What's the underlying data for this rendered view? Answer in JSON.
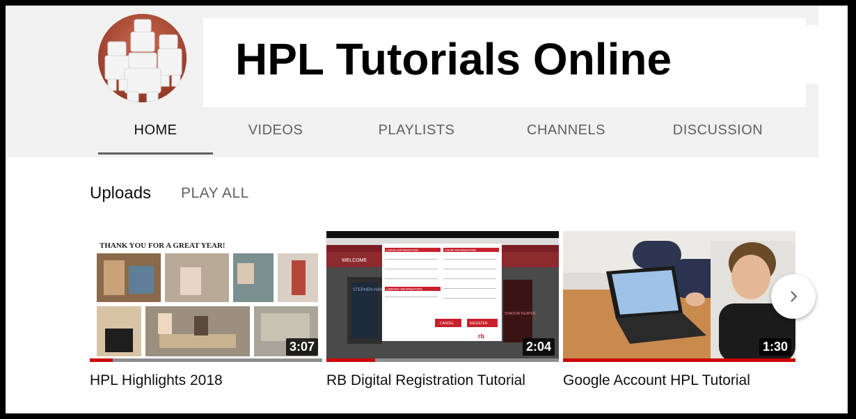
{
  "channel": {
    "title": "HPL Tutorials Online"
  },
  "tabs": [
    {
      "label": "HOME",
      "active": true
    },
    {
      "label": "VIDEOS"
    },
    {
      "label": "PLAYLISTS"
    },
    {
      "label": "CHANNELS"
    },
    {
      "label": "DISCUSSION"
    }
  ],
  "section": {
    "title": "Uploads",
    "play_all": "PLAY ALL"
  },
  "videos": [
    {
      "title": "HPL Highlights 2018",
      "duration": "3:07",
      "progress": 0.1,
      "thumb_caption": "THANK YOU FOR A GREAT YEAR!"
    },
    {
      "title": "RB Digital Registration Tutorial",
      "duration": "2:04",
      "progress": 0.21,
      "thumb": {
        "welcome": "WELCOME",
        "login_info": "LOGIN INFORMATION",
        "your_info": "YOUR INFORMATION",
        "library_info": "LIBRARY INFORMATION",
        "cancel": "CANCEL",
        "register": "REGISTER",
        "book1": "STEPHEN HAWKING",
        "book2": "SHADOW REAPER",
        "logo": "rb"
      }
    },
    {
      "title": "Google Account HPL Tutorial",
      "duration": "1:30",
      "progress": 1.0
    }
  ],
  "icons": {
    "next": "chevron-right-icon"
  },
  "colors": {
    "accent": "#cc0000",
    "text": "#0f0f0f",
    "muted": "#606060",
    "header_bg": "#f1f1f1"
  }
}
